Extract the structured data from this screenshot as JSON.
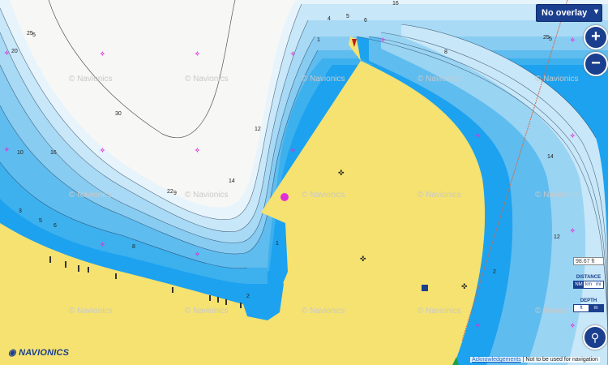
{
  "controls": {
    "overlay_select": "No overlay",
    "zoom_in": "+",
    "zoom_out": "−",
    "scale_value": "98.67",
    "scale_unit": "ft",
    "distance_label": "DISTANCE",
    "distance_units": [
      "NM",
      "km",
      "mi"
    ],
    "distance_active": "NM",
    "depth_label": "DEPTH",
    "depth_units": [
      "ft",
      "m"
    ],
    "depth_active": "m"
  },
  "branding": {
    "logo": "NAVIONICS"
  },
  "footer": {
    "ack_link": "Acknowledgements",
    "notice": "Not to be used for navigation"
  },
  "watermark": "© Navionics",
  "depth_labels": [
    "25",
    "5",
    "20",
    "30",
    "10",
    "16",
    "22",
    "9",
    "3",
    "5",
    "6",
    "8",
    "12",
    "14",
    "1",
    "4",
    "5",
    "6",
    "16",
    "8",
    "25",
    "5",
    "14",
    "12",
    "2",
    "1",
    "2"
  ],
  "colors": {
    "land": "#f5e270",
    "water_light": "#f5f5f3",
    "water_shallow": "#1da2ef",
    "water_mid": "#6cc3f1",
    "water_deep": "#cde9f8",
    "ui_blue": "#1b3f8f"
  }
}
